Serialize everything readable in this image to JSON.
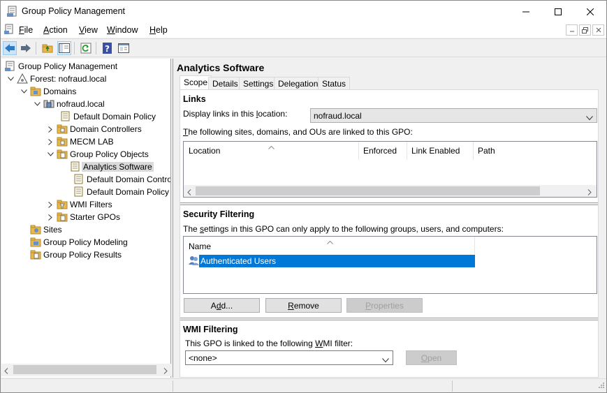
{
  "window": {
    "title": "Group Policy Management"
  },
  "menu": [
    {
      "label": "File",
      "accel": "F",
      "rest": "ile"
    },
    {
      "label": "Action",
      "accel": "A",
      "rest": "ction"
    },
    {
      "label": "View",
      "accel": "V",
      "rest": "iew"
    },
    {
      "label": "Window",
      "accel": "W",
      "rest": "indow"
    },
    {
      "label": "Help",
      "accel": "H",
      "rest": "elp"
    }
  ],
  "toolbar": {
    "icons": [
      "back-icon",
      "forward-icon",
      "up-folder-icon",
      "show-hide-tree-icon",
      "refresh-icon",
      "help-icon",
      "properties-icon"
    ]
  },
  "tree": {
    "root": "Group Policy Management",
    "forest": "Forest: nofraud.local",
    "domains": "Domains",
    "domain": "nofraud.local",
    "default_domain_policy": "Default Domain Policy",
    "domain_controllers": "Domain Controllers",
    "mecm_lab": "MECM LAB",
    "gpo_container": "Group Policy Objects",
    "gpo_items": [
      "Analytics Software",
      "Default Domain Contro",
      "Default Domain Policy"
    ],
    "wmi_filters": "WMI Filters",
    "starter_gpos": "Starter GPOs",
    "sites": "Sites",
    "modeling": "Group Policy Modeling",
    "results": "Group Policy Results"
  },
  "gpo": {
    "name": "Analytics Software",
    "tabs": [
      "Scope",
      "Details",
      "Settings",
      "Delegation",
      "Status"
    ],
    "active_tab": "Scope",
    "links": {
      "heading": "Links",
      "display_label_pre": "Display links in this ",
      "display_label_accel": "l",
      "display_label_post": "ocation:",
      "location_value": "nofraud.local",
      "linked_text_accel": "T",
      "linked_text_rest": "he following sites, domains, and OUs are linked to this GPO:",
      "columns": [
        "Location",
        "Enforced",
        "Link Enabled",
        "Path"
      ]
    },
    "security": {
      "heading": "Security Filtering",
      "desc_pre": "The ",
      "desc_accel": "s",
      "desc_post": "ettings in this GPO can only apply to the following groups, users, and computers:",
      "column": "Name",
      "entries": [
        "Authenticated Users"
      ],
      "add_label": "Add...",
      "add_accel": "d",
      "remove_label": "Remove",
      "remove_accel": "R",
      "properties_label": "Properties",
      "properties_accel": "P"
    },
    "wmi": {
      "heading": "WMI Filtering",
      "desc_pre": "This GPO is linked to the following ",
      "desc_accel": "W",
      "desc_post": "MI filter:",
      "value": "<none>",
      "open_label": "Open",
      "open_accel": "O"
    }
  },
  "colors": {
    "selection": "#0078d7",
    "folder": "#e8b84b"
  }
}
